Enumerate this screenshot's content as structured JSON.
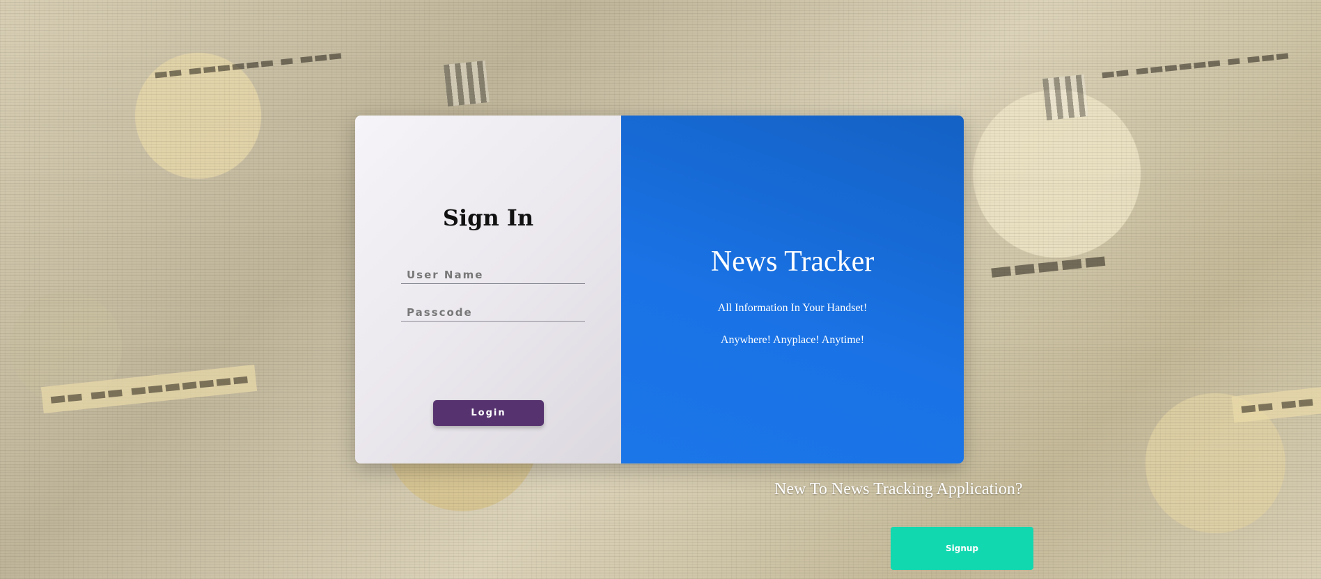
{
  "colors": {
    "left_panel": "#ece9f0",
    "right_panel": "#1a72e4",
    "login_button": "#56336f",
    "signup_button": "#12d8b0"
  },
  "icons": {
    "background": "newspaper-collage-background"
  },
  "signin": {
    "title": "Sign In",
    "username_placeholder": "User Name",
    "password_placeholder": "Passcode",
    "login_label": "Login"
  },
  "promo": {
    "title": "News Tracker",
    "tagline_1": "All Information In Your Handset!",
    "tagline_2": "Anywhere! Anyplace! Anytime!"
  },
  "signup": {
    "prompt": "New To News Tracking Application?",
    "button_label": "Signup"
  }
}
